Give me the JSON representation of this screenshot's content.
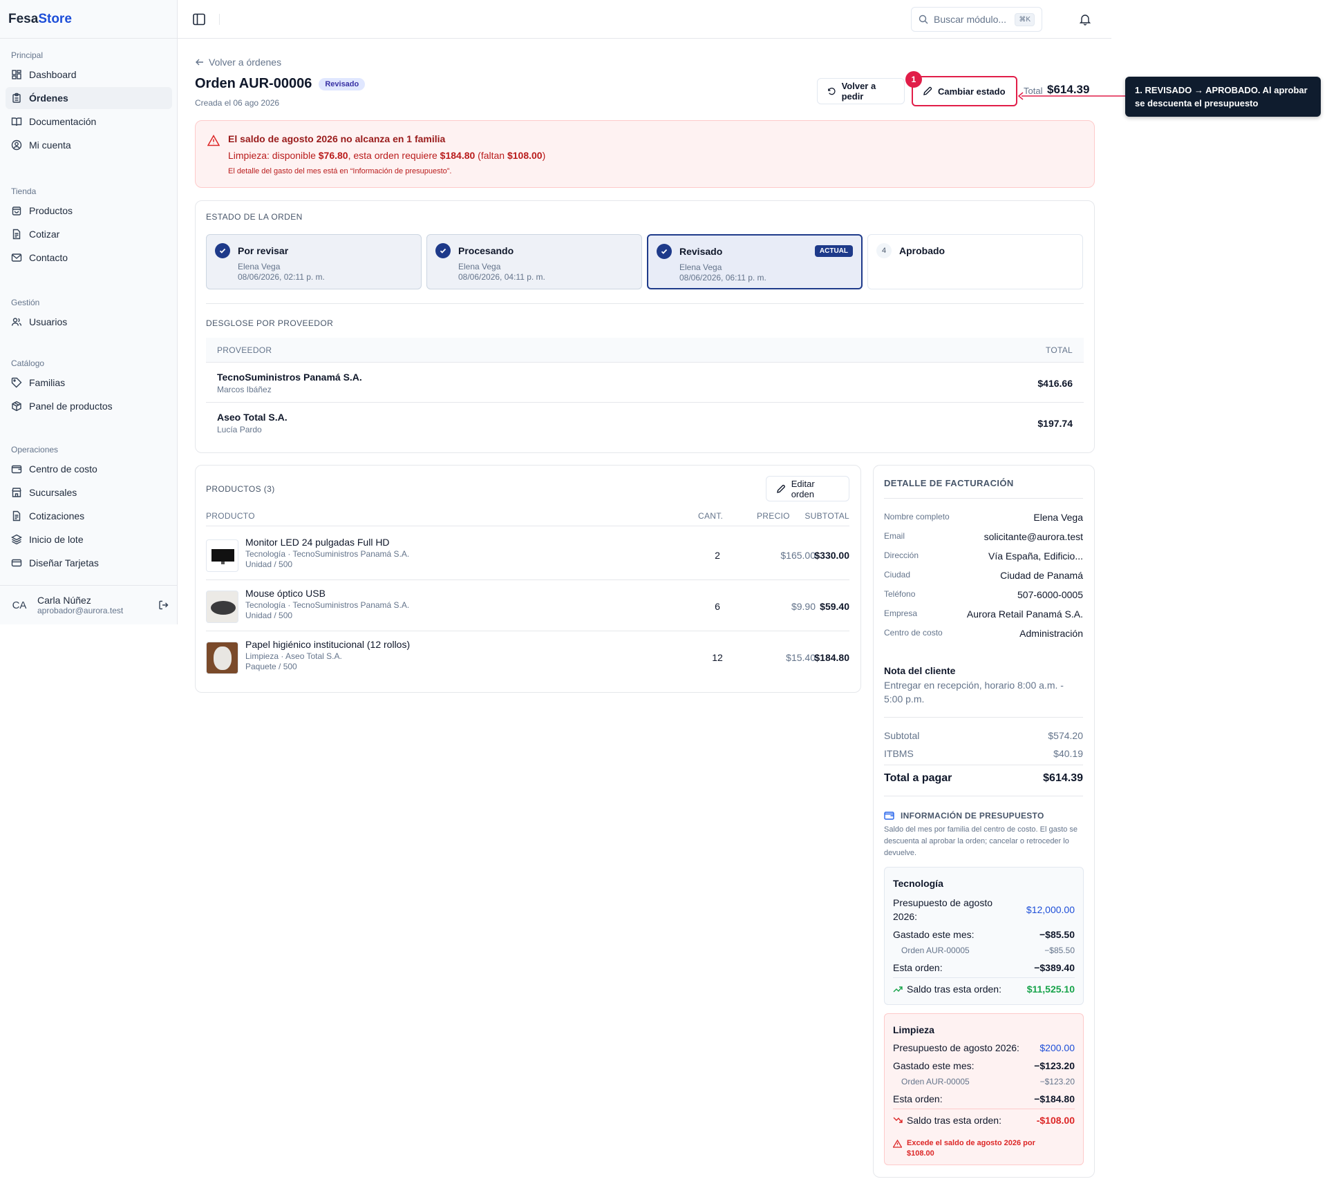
{
  "brand": {
    "part1": "Fesa",
    "part2": "Store"
  },
  "sidebar": {
    "groups": [
      {
        "label": "Principal",
        "items": [
          "Dashboard",
          "Órdenes",
          "Documentación",
          "Mi cuenta"
        ]
      },
      {
        "label": "Tienda",
        "items": [
          "Productos",
          "Cotizar",
          "Contacto"
        ]
      },
      {
        "label": "Gestión",
        "items": [
          "Usuarios"
        ]
      },
      {
        "label": "Catálogo",
        "items": [
          "Familias",
          "Panel de productos"
        ]
      },
      {
        "label": "Operaciones",
        "items": [
          "Centro de costo",
          "Sucursales",
          "Cotizaciones",
          "Inicio de lote",
          "Diseñar Tarjetas"
        ]
      }
    ],
    "active": "Órdenes",
    "user": {
      "initials": "CA",
      "name": "Carla Núñez",
      "email": "aprobador@aurora.test"
    }
  },
  "topbar": {
    "search_placeholder": "Buscar módulo...",
    "shortcut": "⌘K"
  },
  "header": {
    "back": "Volver a órdenes",
    "title": "Orden AUR-00006",
    "badge": "Revisado",
    "created": "Creada el 06 ago 2026",
    "btn_reorder": "Volver a pedir",
    "btn_status": "Cambiar estado",
    "total_label": "Total",
    "total_value": "$614.39"
  },
  "annotation": {
    "number": "1",
    "text": "1. REVISADO → APROBADO. Al aprobar se descuenta el presupuesto"
  },
  "alert": {
    "title": "El saldo de agosto 2026 no alcanza en 1 familia",
    "line_parts": [
      "Limpieza: disponible ",
      "$76.80",
      ", esta orden requiere ",
      "$184.80",
      " (faltan ",
      "$108.00",
      ")"
    ],
    "note": "El detalle del gasto del mes está en “Información de presupuesto”."
  },
  "status": {
    "title": "ESTADO DE LA ORDEN",
    "steps": [
      {
        "label": "Por revisar",
        "who": "Elena Vega",
        "when": "08/06/2026, 02:11 p. m."
      },
      {
        "label": "Procesando",
        "who": "Elena Vega",
        "when": "08/06/2026, 04:11 p. m."
      },
      {
        "label": "Revisado",
        "who": "Elena Vega",
        "when": "08/06/2026, 06:11 p. m.",
        "badge": "ACTUAL"
      },
      {
        "num": "4",
        "label": "Aprobado"
      }
    ]
  },
  "suppliers": {
    "title": "DESGLOSE POR PROVEEDOR",
    "col_supplier": "PROVEEDOR",
    "col_total": "TOTAL",
    "rows": [
      {
        "name": "TecnoSuministros Panamá S.A.",
        "contact": "Marcos Ibáñez",
        "total": "$416.66"
      },
      {
        "name": "Aseo Total S.A.",
        "contact": "Lucía Pardo",
        "total": "$197.74"
      }
    ]
  },
  "products": {
    "title": "PRODUCTOS (3)",
    "edit": "Editar orden",
    "cols": [
      "PRODUCTO",
      "CANT.",
      "PRECIO",
      "SUBTOTAL"
    ],
    "rows": [
      {
        "name": "Monitor LED 24 pulgadas Full HD",
        "cat": "Tecnología · TecnoSuministros Panamá S.A.",
        "unit": "Unidad / 500",
        "qty": "2",
        "price": "$165.00",
        "subtotal": "$330.00"
      },
      {
        "name": "Mouse óptico USB",
        "cat": "Tecnología · TecnoSuministros Panamá S.A.",
        "unit": "Unidad / 500",
        "qty": "6",
        "price": "$9.90",
        "subtotal": "$59.40"
      },
      {
        "name": "Papel higiénico institucional (12 rollos)",
        "cat": "Limpieza · Aseo Total S.A.",
        "unit": "Paquete / 500",
        "qty": "12",
        "price": "$15.40",
        "subtotal": "$184.80"
      }
    ]
  },
  "billing": {
    "title": "DETALLE DE FACTURACIÓN",
    "fields": [
      {
        "k": "Nombre completo",
        "v": "Elena Vega"
      },
      {
        "k": "Email",
        "v": "solicitante@aurora.test"
      },
      {
        "k": "Dirección",
        "v": "Vía España, Edificio..."
      },
      {
        "k": "Ciudad",
        "v": "Ciudad de Panamá"
      },
      {
        "k": "Teléfono",
        "v": "507-6000-0005"
      },
      {
        "k": "Empresa",
        "v": "Aurora Retail Panamá S.A."
      },
      {
        "k": "Centro de costo",
        "v": "Administración"
      }
    ],
    "note_title": "Nota del cliente",
    "note": "Entregar en recepción, horario 8:00 a.m. - 5:00 p.m.",
    "subtotal_label": "Subtotal",
    "subtotal": "$574.20",
    "tax_label": "ITBMS",
    "tax": "$40.19",
    "total_label": "Total a pagar",
    "total": "$614.39"
  },
  "budget": {
    "title": "INFORMACIÓN DE PRESUPUESTO",
    "desc": "Saldo del mes por familia del centro de costo. El gasto se descuenta al aprobar la orden; cancelar o retroceder lo devuelve.",
    "families": [
      {
        "name": "Tecnología",
        "budget_label": "Presupuesto de agosto 2026:",
        "budget": "$12,000.00",
        "spent_label": "Gastado este mes:",
        "spent": "−$85.50",
        "order_ref": "Orden AUR-00005",
        "order_ref_val": "−$85.50",
        "this_label": "Esta orden:",
        "this": "−$389.40",
        "after_label": "Saldo tras esta orden:",
        "after": "$11,525.10"
      },
      {
        "name": "Limpieza",
        "budget_label": "Presupuesto de agosto 2026:",
        "budget": "$200.00",
        "spent_label": "Gastado este mes:",
        "spent": "−$123.20",
        "order_ref": "Orden AUR-00005",
        "order_ref_val": "−$123.20",
        "this_label": "Esta orden:",
        "this": "−$184.80",
        "after_label": "Saldo tras esta orden:",
        "after": "-$108.00",
        "warning": "Excede el saldo de agosto 2026 por $108.00"
      }
    ]
  },
  "colors": {
    "accent": "#1e3a8a",
    "danger": "#dc2626",
    "success": "#16a34a",
    "annotation": "#e11d48"
  }
}
